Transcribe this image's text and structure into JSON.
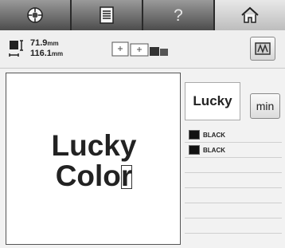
{
  "tabs": [
    {
      "name": "sewing-settings"
    },
    {
      "name": "document"
    },
    {
      "name": "help"
    },
    {
      "name": "home"
    }
  ],
  "size": {
    "width": "71.9",
    "width_unit": "mm",
    "height": "116.1",
    "height_unit": "mm"
  },
  "canvas": {
    "line1": "Lucky",
    "line2": "Colo",
    "line2_last": "r"
  },
  "preview": {
    "text": "Lucky"
  },
  "buttons": {
    "min_label": "min"
  },
  "colors": [
    {
      "name": "BLACK",
      "swatch": "#111111"
    },
    {
      "name": "BLACK",
      "swatch": "#111111"
    }
  ]
}
